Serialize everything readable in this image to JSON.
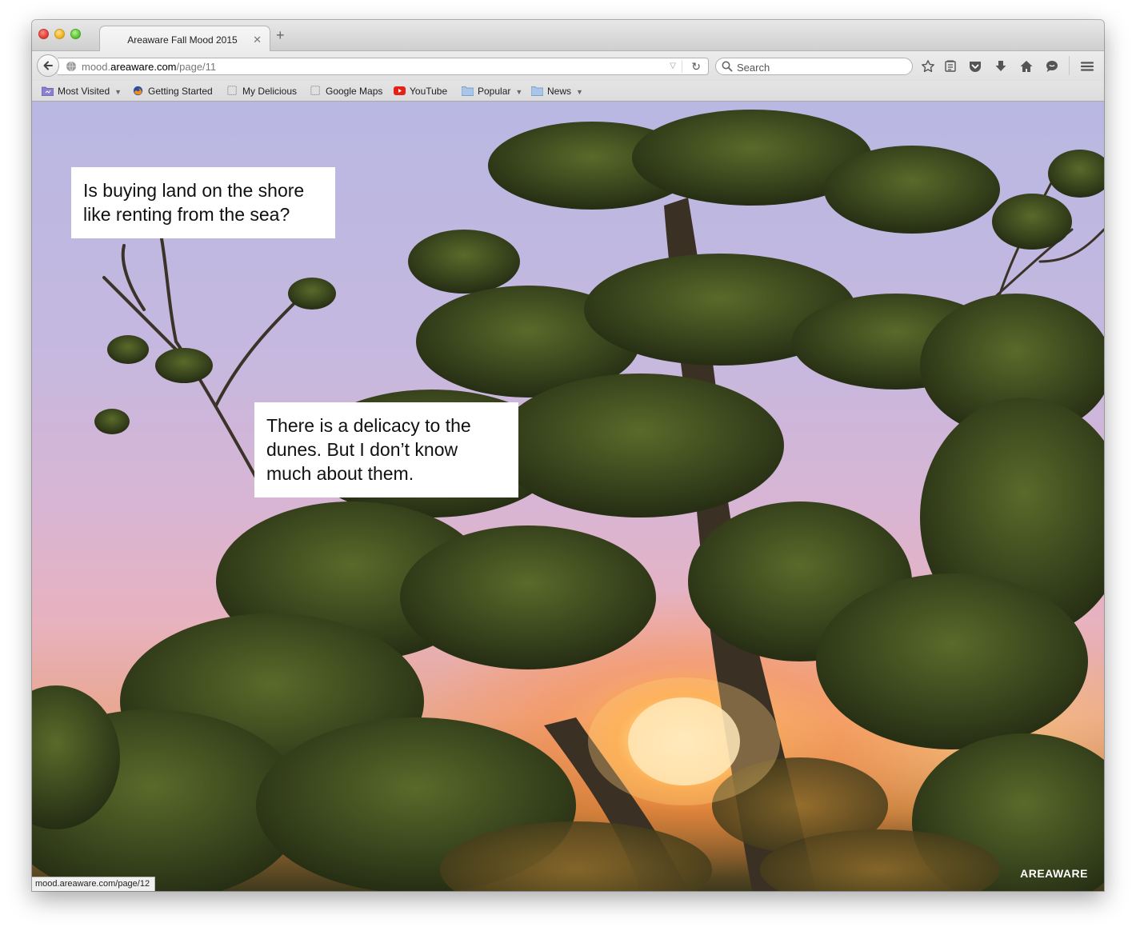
{
  "window": {
    "tab": {
      "title": "Areaware Fall Mood 2015",
      "close_glyph": "✕"
    },
    "new_tab_glyph": "+"
  },
  "navbar": {
    "url": {
      "prefix": "mood.",
      "domain": "areaware.com",
      "path": "/page/11"
    },
    "search_placeholder": "Search"
  },
  "bookmarks": [
    {
      "label": "Most Visited",
      "icon": "most-visited-icon",
      "has_menu": true
    },
    {
      "label": "Getting Started",
      "icon": "firefox-icon",
      "has_menu": false
    },
    {
      "label": "My Delicious",
      "icon": "bookmark-page-icon",
      "has_menu": false
    },
    {
      "label": "Google Maps",
      "icon": "bookmark-page-icon",
      "has_menu": false
    },
    {
      "label": "YouTube",
      "icon": "youtube-icon",
      "has_menu": false
    },
    {
      "label": "Popular",
      "icon": "folder-icon",
      "has_menu": true
    },
    {
      "label": "News",
      "icon": "folder-icon",
      "has_menu": true
    }
  ],
  "page": {
    "caption_1": "Is buying land on the shore like renting from the sea?",
    "caption_2": "There is a delicacy to the dunes. But I don’t know much about them.",
    "brand": "AREAWARE"
  },
  "status": {
    "link_url": "mood.areaware.com/page/12"
  },
  "colors": {
    "sky_top": "#b9b8e2",
    "sky_pink": "#e8b2bf",
    "sun_glow": "#ffdc8c",
    "foliage": "#3e4a22"
  }
}
